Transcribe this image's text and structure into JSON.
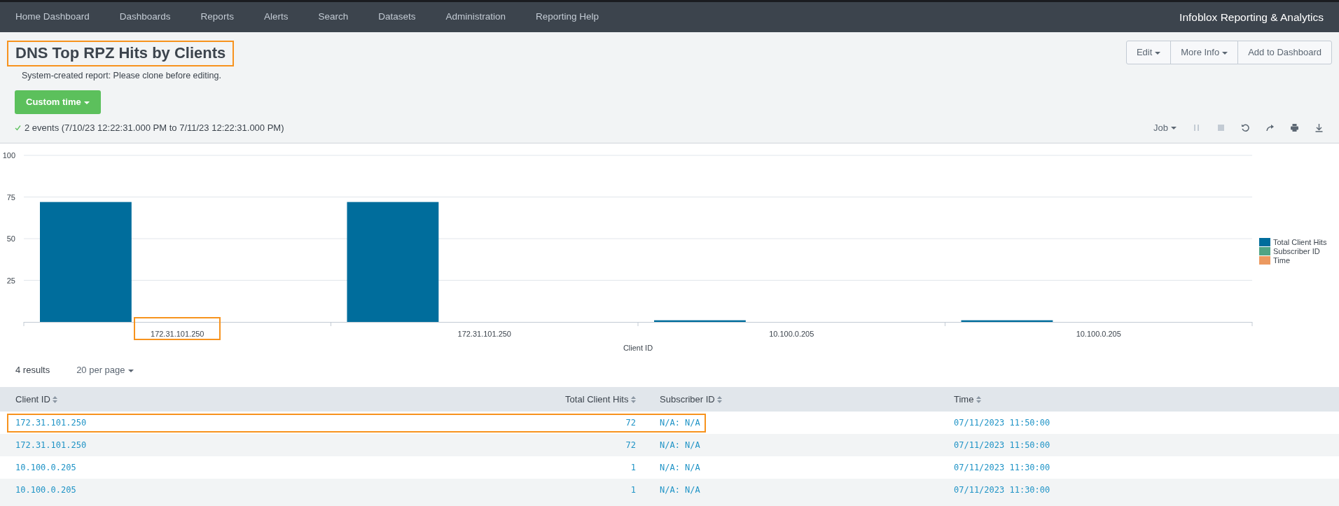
{
  "nav": {
    "items": [
      "Home Dashboard",
      "Dashboards",
      "Reports",
      "Alerts",
      "Search",
      "Datasets",
      "Administration",
      "Reporting Help"
    ],
    "brand": "Infoblox Reporting & Analytics"
  },
  "report": {
    "title": "DNS Top RPZ Hits by Clients",
    "title_highlighted": true,
    "note": "System-created report: Please clone before editing.",
    "actions": [
      {
        "label": "Edit",
        "dropdown": true
      },
      {
        "label": "More Info",
        "dropdown": true
      },
      {
        "label": "Add to Dashboard",
        "dropdown": false
      }
    ],
    "time_button": "Custom time",
    "status": "2 events (7/10/23 12:22:31.000 PM to 7/11/23 12:22:31.000 PM)",
    "job_menu": "Job",
    "job_tools": [
      {
        "kind": "pause",
        "disabled": true
      },
      {
        "kind": "stop",
        "disabled": true
      },
      {
        "kind": "refresh",
        "disabled": false
      },
      {
        "kind": "share",
        "disabled": false
      },
      {
        "kind": "print",
        "disabled": false
      },
      {
        "kind": "download",
        "disabled": false
      }
    ]
  },
  "chart": {
    "highlighted_categories": [
      true,
      false,
      false,
      false
    ],
    "chart_data": {
      "type": "bar",
      "xlabel": "Client ID",
      "categories": [
        "172.31.101.250",
        "172.31.101.250",
        "10.100.0.205",
        "10.100.0.205"
      ],
      "series": [
        {
          "name": "Total Client Hits",
          "color": "#006d9c",
          "values": [
            72,
            72,
            1,
            1
          ]
        },
        {
          "name": "Subscriber ID",
          "color": "#4fa484",
          "values": [
            null,
            null,
            null,
            null
          ]
        },
        {
          "name": "Time",
          "color": "#ec9960",
          "values": [
            null,
            null,
            null,
            null
          ]
        }
      ],
      "grid": true,
      "ylim": [
        0,
        100
      ],
      "yticks": [
        25,
        50,
        75,
        100
      ]
    }
  },
  "results": {
    "count": "4 results",
    "per_page": "20 per page"
  },
  "table": {
    "columns": [
      {
        "label": "Client ID"
      },
      {
        "label": "Total Client Hits"
      },
      {
        "label": "Subscriber ID"
      },
      {
        "label": "Time"
      }
    ],
    "rows": [
      {
        "highlighted": true,
        "cells": [
          "172.31.101.250",
          "72",
          "N/A: N/A",
          "07/11/2023 11:50:00"
        ]
      },
      {
        "highlighted": false,
        "cells": [
          "172.31.101.250",
          "72",
          "N/A: N/A",
          "07/11/2023 11:50:00"
        ]
      },
      {
        "highlighted": false,
        "cells": [
          "10.100.0.205",
          "1",
          "N/A: N/A",
          "07/11/2023 11:30:00"
        ]
      },
      {
        "highlighted": false,
        "cells": [
          "10.100.0.205",
          "1",
          "N/A: N/A",
          "07/11/2023 11:30:00"
        ]
      }
    ]
  }
}
